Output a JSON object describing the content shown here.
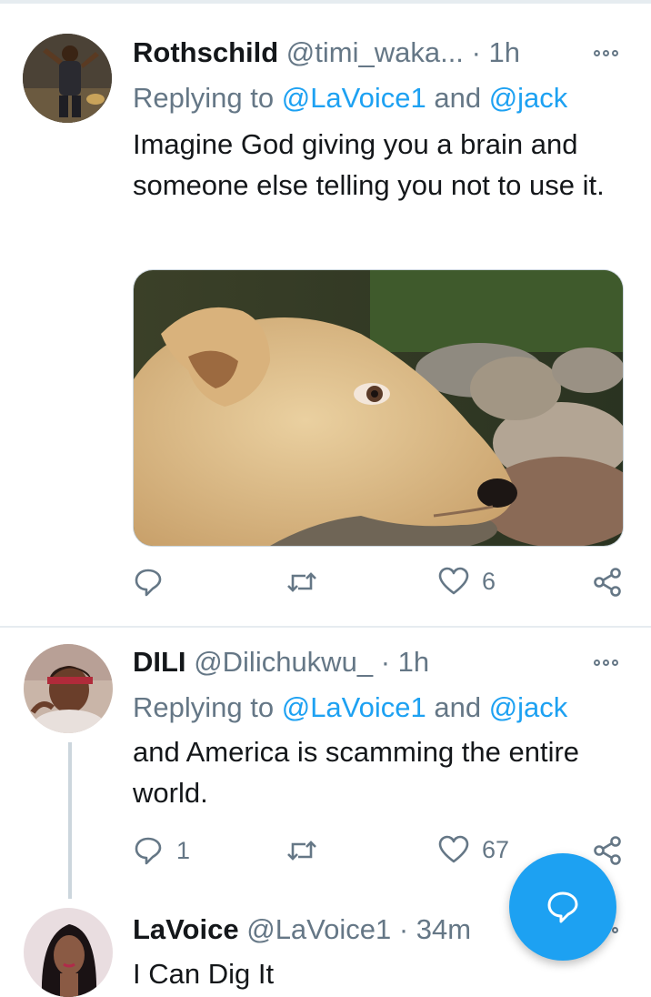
{
  "tweets": [
    {
      "name": "Rothschild",
      "handle": "@timi_waka...",
      "time": "· 1h",
      "reply_prefix": "Replying to ",
      "mention1": "@LaVoice1",
      "reply_and": " and ",
      "mention2": "@jack",
      "text": "Imagine God giving you a brain and someone else telling you not to use it.",
      "reply_count": "",
      "retweet_count": "",
      "like_count": "6"
    },
    {
      "name": "DILI",
      "handle": "@Dilichukwu_",
      "time": "· 1h",
      "reply_prefix": "Replying to ",
      "mention1": "@LaVoice1",
      "reply_and": " and ",
      "mention2": "@jack",
      "text": "and America is scamming the entire world.",
      "reply_count": "1",
      "retweet_count": "",
      "like_count": "67"
    },
    {
      "name": "LaVoice",
      "handle": "@LaVoice1",
      "time": "· 34m",
      "text": "I Can Dig It"
    }
  ],
  "icons": {
    "reply": "reply-icon",
    "retweet": "retweet-icon",
    "like": "heart-icon",
    "share": "share-icon",
    "more": "more-icon",
    "compose": "compose-reply-icon"
  },
  "colors": {
    "accent": "#1da1f2",
    "secondary_text": "#657786",
    "divider": "#e6ecf0"
  }
}
